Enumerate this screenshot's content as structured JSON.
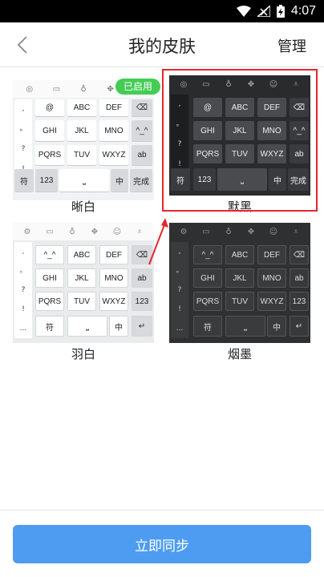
{
  "status_bar": {
    "time": "4:07"
  },
  "header": {
    "title": "我的皮肤",
    "manage_label": "管理"
  },
  "keyboard_labels": {
    "row1": [
      "@",
      "ABC",
      "DEF"
    ],
    "row2": [
      "GHI",
      "JKL",
      "MNO"
    ],
    "row3": [
      "PQRS",
      "TUV",
      "WXYZ"
    ],
    "emoticon": "^_^",
    "ab": "ab",
    "symbol": "符",
    "num": "123",
    "chinese": "中",
    "done": "完成",
    "side_symbols": [
      ",",
      "。",
      "?",
      "!"
    ],
    "feather_side": [
      ",",
      "。",
      "?",
      "!",
      "..."
    ]
  },
  "skins": [
    {
      "name": "晰白",
      "badge": "已启用"
    },
    {
      "name": "默黑"
    },
    {
      "name": "羽白"
    },
    {
      "name": "烟墨"
    }
  ],
  "bottom": {
    "sync_label": "立即同步"
  },
  "colors": {
    "accent": "#4e9cf2",
    "badge": "#44cc55",
    "highlight": "#e8262b"
  }
}
